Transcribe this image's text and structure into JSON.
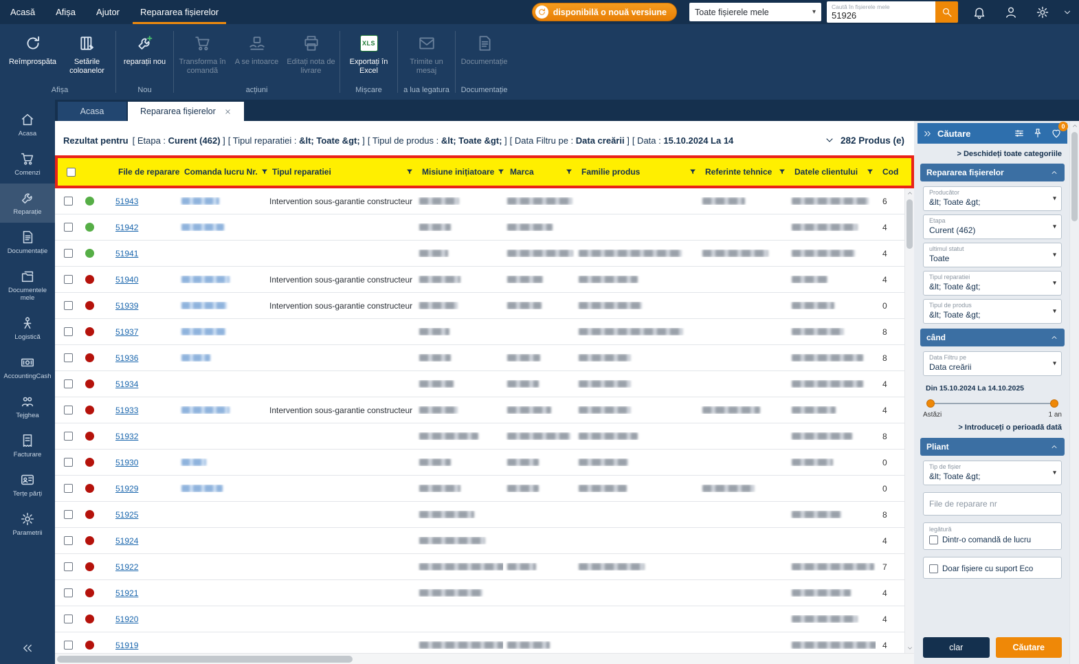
{
  "topbar": {
    "menu": [
      {
        "label": "Acasă",
        "active": false
      },
      {
        "label": "Afișa",
        "active": false
      },
      {
        "label": "Ajutor",
        "active": false
      },
      {
        "label": "Repararea fișierelor",
        "active": true
      }
    ],
    "update_button": "disponibilă o nouă versiune",
    "scope_dropdown": "Toate fișierele mele",
    "search": {
      "placeholder": "Caută în fișierele mele",
      "value": "51926"
    }
  },
  "ribbon": {
    "groups": [
      {
        "label": "Afișa",
        "buttons": [
          {
            "label": "Reîmprospăta",
            "icon": "refresh",
            "disabled": false
          },
          {
            "label": "Setările coloanelor",
            "icon": "column-settings",
            "disabled": false
          }
        ]
      },
      {
        "label": "Nou",
        "buttons": [
          {
            "label": "reparații nou",
            "icon": "wrench-plus",
            "disabled": false
          }
        ]
      },
      {
        "label": "acțiuni",
        "buttons": [
          {
            "label": "Transforma în comandă",
            "icon": "cart",
            "disabled": true
          },
          {
            "label": "A se intoarce",
            "icon": "return-hands",
            "disabled": true
          },
          {
            "label": "Editați nota de livrare",
            "icon": "printer",
            "disabled": true
          }
        ]
      },
      {
        "label": "Mișcare",
        "buttons": [
          {
            "label": "Exportați în Excel",
            "icon": "excel",
            "disabled": false
          }
        ]
      },
      {
        "label": "a lua legatura",
        "buttons": [
          {
            "label": "Trimite un mesaj",
            "icon": "mail",
            "disabled": true
          }
        ]
      },
      {
        "label": "Documentație",
        "buttons": [
          {
            "label": "Documentație",
            "icon": "document",
            "disabled": true
          }
        ]
      }
    ]
  },
  "tabs": [
    {
      "label": "Acasa",
      "active": false
    },
    {
      "label": "Repararea fișierelor",
      "active": true
    }
  ],
  "results": {
    "prefix": "Rezultat pentru",
    "filters": [
      {
        "label": "Etapa",
        "value": "Curent (462)"
      },
      {
        "label": "Tipul reparatiei",
        "value": "&lt; Toate &gt;"
      },
      {
        "label": "Tipul de produs",
        "value": "&lt; Toate &gt;"
      },
      {
        "label": "Data Filtru pe",
        "value": "Data creării"
      },
      {
        "label": "Data",
        "value": "15.10.2024 La 14",
        "cut": true
      }
    ],
    "count": "282 Produs (e)"
  },
  "table": {
    "columns": [
      {
        "label": "File de reparare nr",
        "filter": false
      },
      {
        "label": "Comanda lucru Nr.",
        "filter": true
      },
      {
        "label": "Tipul reparatiei",
        "filter": true
      },
      {
        "label": "Misiune inițiatoare",
        "filter": true
      },
      {
        "label": "Marca",
        "filter": true
      },
      {
        "label": "Familie produs",
        "filter": true
      },
      {
        "label": "Referinte tehnice",
        "filter": true
      },
      {
        "label": "Datele clientului",
        "filter": true
      },
      {
        "label": "Cod",
        "filter": false
      }
    ],
    "rows": [
      {
        "file_nr": "51943",
        "status": "green",
        "wo": 55,
        "type": "Intervention sous-garantie constructeur",
        "mission": 58,
        "marca": 95,
        "familie": 0,
        "referinte": 62,
        "client": 112,
        "cod": "6"
      },
      {
        "file_nr": "51942",
        "status": "green",
        "wo": 62,
        "type": "",
        "mission": 46,
        "marca": 66,
        "familie": 0,
        "referinte": 0,
        "client": 96,
        "cod": "4"
      },
      {
        "file_nr": "51941",
        "status": "green",
        "wo": 0,
        "type": "",
        "mission": 42,
        "marca": 96,
        "familie": 150,
        "referinte": 96,
        "client": 92,
        "cod": "4"
      },
      {
        "file_nr": "51940",
        "status": "red",
        "wo": 70,
        "type": "Intervention sous-garantie constructeur",
        "mission": 60,
        "marca": 52,
        "familie": 86,
        "referinte": 0,
        "client": 52,
        "cod": "4"
      },
      {
        "file_nr": "51939",
        "status": "red",
        "wo": 66,
        "type": "Intervention sous-garantie constructeur",
        "mission": 56,
        "marca": 50,
        "familie": 92,
        "referinte": 0,
        "client": 62,
        "cod": "0"
      },
      {
        "file_nr": "51937",
        "status": "red",
        "wo": 64,
        "type": "",
        "mission": 44,
        "marca": 0,
        "familie": 152,
        "referinte": 0,
        "client": 76,
        "cod": "8"
      },
      {
        "file_nr": "51936",
        "status": "red",
        "wo": 42,
        "type": "",
        "mission": 46,
        "marca": 48,
        "familie": 76,
        "referinte": 0,
        "client": 104,
        "cod": "8"
      },
      {
        "file_nr": "51934",
        "status": "red",
        "wo": 0,
        "type": "",
        "mission": 50,
        "marca": 46,
        "familie": 76,
        "referinte": 0,
        "client": 104,
        "cod": "4"
      },
      {
        "file_nr": "51933",
        "status": "red",
        "wo": 70,
        "type": "Intervention sous-garantie constructeur",
        "mission": 56,
        "marca": 64,
        "familie": 76,
        "referinte": 84,
        "client": 64,
        "cod": "4"
      },
      {
        "file_nr": "51932",
        "status": "red",
        "wo": 0,
        "type": "",
        "mission": 86,
        "marca": 92,
        "familie": 86,
        "referinte": 0,
        "client": 88,
        "cod": "8"
      },
      {
        "file_nr": "51930",
        "status": "red",
        "wo": 36,
        "type": "",
        "mission": 46,
        "marca": 46,
        "familie": 72,
        "referinte": 0,
        "client": 60,
        "cod": "0"
      },
      {
        "file_nr": "51929",
        "status": "red",
        "wo": 60,
        "type": "",
        "mission": 60,
        "marca": 46,
        "familie": 70,
        "referinte": 76,
        "client": 0,
        "cod": "0"
      },
      {
        "file_nr": "51925",
        "status": "red",
        "wo": 0,
        "type": "",
        "mission": 80,
        "marca": 0,
        "familie": 0,
        "referinte": 0,
        "client": 72,
        "cod": "8"
      },
      {
        "file_nr": "51924",
        "status": "red",
        "wo": 0,
        "type": "",
        "mission": 96,
        "marca": 0,
        "familie": 0,
        "referinte": 0,
        "client": 0,
        "cod": "4"
      },
      {
        "file_nr": "51922",
        "status": "red",
        "wo": 0,
        "type": "",
        "mission": 130,
        "marca": 42,
        "familie": 96,
        "referinte": 0,
        "client": 120,
        "cod": "7"
      },
      {
        "file_nr": "51921",
        "status": "red",
        "wo": 0,
        "type": "",
        "mission": 92,
        "marca": 0,
        "familie": 0,
        "referinte": 0,
        "client": 86,
        "cod": "4"
      },
      {
        "file_nr": "51920",
        "status": "red",
        "wo": 0,
        "type": "",
        "mission": 0,
        "marca": 0,
        "familie": 0,
        "referinte": 0,
        "client": 96,
        "cod": "4"
      },
      {
        "file_nr": "51919",
        "status": "red",
        "wo": 0,
        "type": "",
        "mission": 124,
        "marca": 62,
        "familie": 0,
        "referinte": 0,
        "client": 128,
        "cod": "4"
      }
    ]
  },
  "sidebar": {
    "items": [
      {
        "label": "Acasa",
        "icon": "home",
        "active": false
      },
      {
        "label": "Comenzi",
        "icon": "cart",
        "active": false
      },
      {
        "label": "Reparație",
        "icon": "wrench",
        "active": true
      },
      {
        "label": "Documentație",
        "icon": "document",
        "active": false
      },
      {
        "label": "Documentele mele",
        "icon": "my-documents",
        "active": false
      },
      {
        "label": "Logistică",
        "icon": "logistics",
        "active": false
      },
      {
        "label": "AccountingCash",
        "icon": "cash",
        "active": false
      },
      {
        "label": "Tejghea",
        "icon": "counter",
        "active": false
      },
      {
        "label": "Facturare",
        "icon": "invoice",
        "active": false
      },
      {
        "label": "Terțe părți",
        "icon": "id-card",
        "active": false
      },
      {
        "label": "Parametrii",
        "icon": "gear",
        "active": false
      }
    ]
  },
  "search_panel": {
    "title": "Căutare",
    "open_all": "> Deschideți toate categoriile",
    "favorites_badge": "0",
    "repair_section": {
      "title": "Repararea fișierelor",
      "fields": [
        {
          "label": "Producător",
          "value": "&lt; Toate &gt;"
        },
        {
          "label": "Etapa",
          "value": "Curent (462)"
        },
        {
          "label": "ultimul statut",
          "value": "Toate"
        },
        {
          "label": "Tipul reparatiei",
          "value": "&lt; Toate &gt;"
        },
        {
          "label": "Tipul de produs",
          "value": "&lt; Toate &gt;"
        }
      ]
    },
    "when": {
      "title": "când",
      "field": {
        "label": "Data Filtru pe",
        "value": "Data creării"
      },
      "range_text": "Din 15.10.2024 La 14.10.2025",
      "slider_left": "Astăzi",
      "slider_right": "1 an",
      "period_link": "> Introduceți o perioadă dată"
    },
    "folder": {
      "title": "Pliant",
      "field": {
        "label": "Tip de fișier",
        "value": "&lt; Toate &gt;"
      },
      "file_input_placeholder": "File de reparare nr",
      "link_group_label": "legătură",
      "link_checkbox": "Dintr-o comandă de lucru",
      "eco_checkbox": "Doar fișiere cu suport Eco",
      "clear_button": "clar",
      "search_button": "Căutare"
    }
  }
}
